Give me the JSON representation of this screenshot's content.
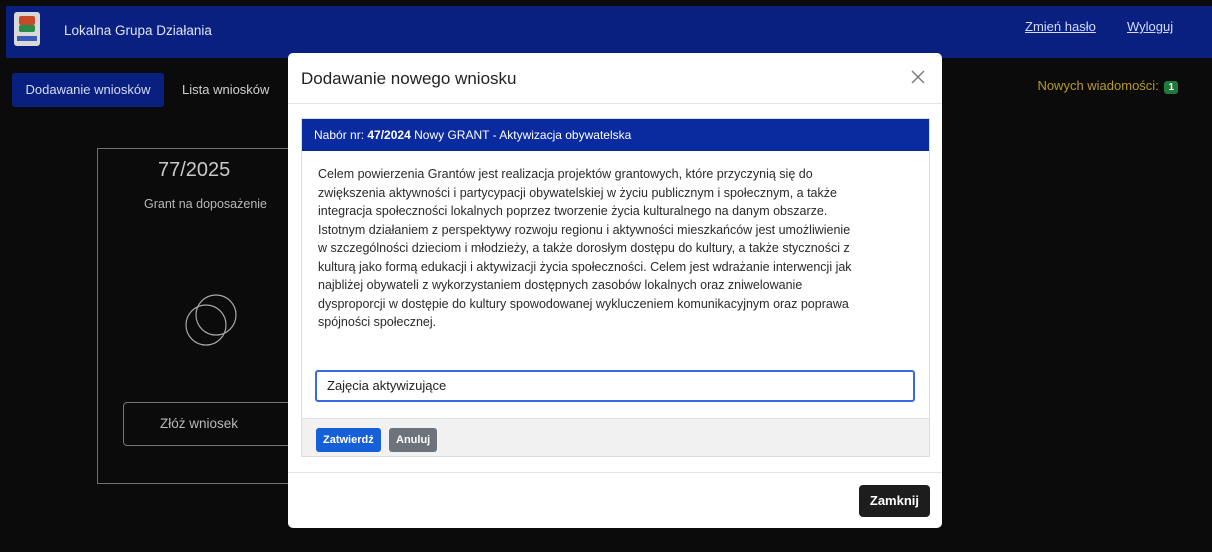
{
  "header": {
    "app_title": "Lokalna Grupa Działania",
    "change_password": "Zmień hasło",
    "logout": "Wyloguj",
    "logo_icon": "lgd-logo"
  },
  "nav": {
    "tabs": [
      {
        "label": "Dodawanie wniosków",
        "active": true
      },
      {
        "label": "Lista wniosków",
        "active": false
      }
    ],
    "messages_label": "Nowych wiadomości:",
    "messages_count": "1"
  },
  "card": {
    "number": "77/2025",
    "title": "Grant na doposażenie",
    "icon": "overlapping-circles-icon",
    "button": "Złóż wniosek"
  },
  "modal": {
    "title": "Dodawanie nowego wniosku",
    "close_icon": "close-icon",
    "call_prefix": "Nabór nr:",
    "call_number": "47/2024",
    "call_title": "Nowy GRANT - Aktywizacja obywatelska",
    "description_lines": [
      "Celem powierzenia Grantów jest realizacja projektów grantowych, które przyczynią się do",
      "zwiększenia aktywności i partycypacji obywatelskiej w życiu publicznym i społecznym, a także",
      "integracja społeczności lokalnych poprzez tworzenie życia kulturalnego na danym obszarze.",
      "Istotnym działaniem z perspektywy rozwoju regionu i aktywności mieszkańców jest umożliwienie",
      "w szczególności dzieciom i młodzieży, a także dorosłym dostępu do kultury, a także styczności z",
      "kulturą jako formą edukacji i aktywizacji życia społeczności. Celem jest wdrażanie interwencji jak",
      "najbliżej obywateli z wykorzystaniem dostępnych zasobów lokalnych oraz zniwelowanie",
      "dysproporcji w dostępie do kultury spowodowanej wykluczeniem komunikacyjnym oraz poprawa",
      "spójności społecznej."
    ],
    "input_value": "Zajęcia aktywizujące",
    "confirm_button": "Zatwierdź",
    "cancel_button": "Anuluj",
    "close_button": "Zamknij"
  },
  "colors": {
    "navbar": "#0a2080",
    "call_header": "#0a2aa0",
    "confirm": "#1560d8",
    "cancel": "#6d737a",
    "messages_text": "#b79a2a",
    "badge": "#1f7a3a"
  }
}
